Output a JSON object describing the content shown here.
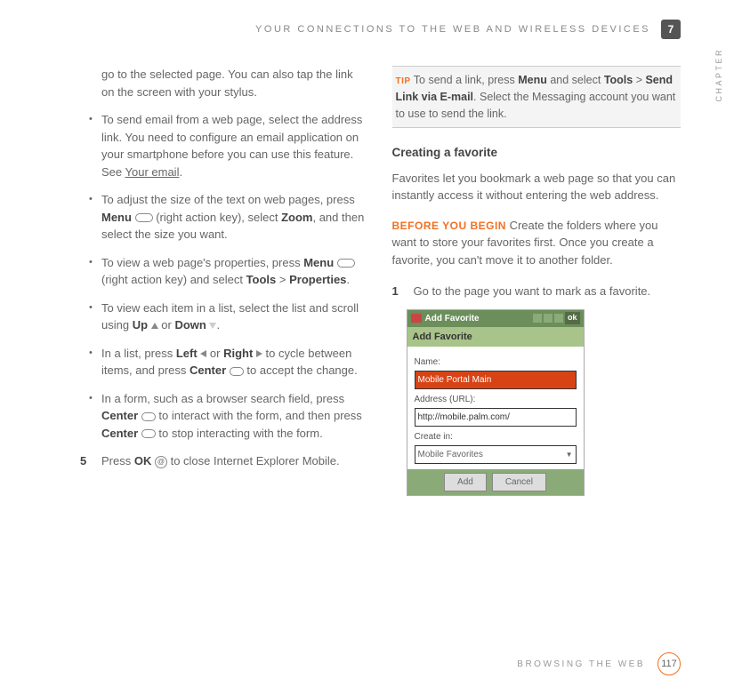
{
  "header": {
    "title": "YOUR CONNECTIONS TO THE WEB AND WIRELESS DEVICES",
    "chapter_number": "7",
    "tab_label": "CHAPTER"
  },
  "left": {
    "intro": "go to the selected page. You can also tap the link on the screen with your stylus.",
    "bullets": {
      "b1": {
        "t1": "To send email from a web page, select the address link. You need to configure an email application on your smartphone before you can use this feature. See ",
        "link": "Your email",
        "t2": "."
      },
      "b2": {
        "t1": "To adjust the size of the text on web pages, press ",
        "menu": "Menu",
        "t2": " (right action key), select ",
        "zoom": "Zoom",
        "t3": ", and then select the size you want."
      },
      "b3": {
        "t1": "To view a web page's properties, press ",
        "menu": "Menu",
        "t2": " (right action key) and select ",
        "tools": "Tools",
        "gt": " > ",
        "props": "Properties",
        "t3": "."
      },
      "b4": {
        "t1": "To view each item in a list, select the list and scroll using ",
        "up": "Up",
        "or": " or ",
        "down": "Down",
        "t2": "."
      },
      "b5": {
        "t1": "In a list, press ",
        "left": "Left",
        "or": " or ",
        "right": "Right",
        "t2": " to cycle between items, and press ",
        "center": "Center",
        "t3": " to accept the change."
      },
      "b6": {
        "t1": "In a form, such as a browser search field, press ",
        "center": "Center",
        "t2": " to interact with the form, and then press ",
        "center2": "Center",
        "t3": " to stop interacting with the form."
      }
    },
    "step5": {
      "num": "5",
      "t1": "Press ",
      "ok": "OK",
      "t2": " to close Internet Explorer Mobile."
    }
  },
  "right": {
    "tip": {
      "label": "TIP",
      "t1": " To send a link, press ",
      "menu": "Menu",
      "t2": " and select ",
      "tools": "Tools",
      "gt": " > ",
      "send": "Send Link via E-mail",
      "t3": ". Select the Messaging account you want to use to send the link."
    },
    "section_title": "Creating a favorite",
    "intro": "Favorites let you bookmark a web page so that you can instantly access it without entering the web address.",
    "before": {
      "label": "BEFORE YOU BEGIN",
      "text": " Create the folders where you want to store your favorites first. Once you create a favorite, you can't move it to another folder."
    },
    "step1": {
      "num": "1",
      "text": "Go to the page you want to mark as a favorite."
    }
  },
  "screenshot": {
    "title": "Add Favorite",
    "ok": "ok",
    "panel_title": "Add Favorite",
    "name_label": "Name:",
    "name_value": "Mobile Portal Main",
    "url_label": "Address (URL):",
    "url_value": "http://mobile.palm.com/",
    "create_in_label": "Create in:",
    "create_in_value": "Mobile Favorites",
    "btn_add": "Add",
    "btn_cancel": "Cancel"
  },
  "footer": {
    "section": "BROWSING THE WEB",
    "page": "117"
  }
}
